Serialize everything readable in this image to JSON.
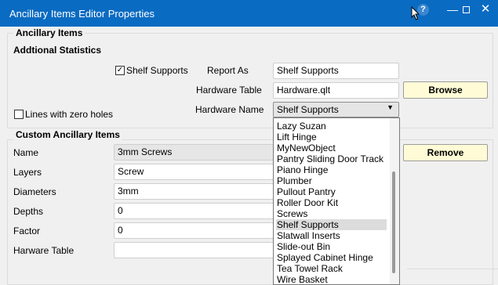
{
  "window": {
    "title": "Ancillary Items Editor Properties",
    "help_symbol": "?",
    "minimize_symbol": "—",
    "close_symbol": "✕"
  },
  "ancillary_group": {
    "title": "Ancillary Items",
    "stats_heading": "Addtional Statistics",
    "shelf_supports_label": "Shelf Supports",
    "shelf_supports_checked": true,
    "lines_zero_holes_label": "Lines with zero holes",
    "lines_zero_holes_checked": false,
    "report_as_label": "Report As",
    "report_as_value": "Shelf Supports",
    "hardware_table_label": "Hardware Table",
    "hardware_table_value": "Hardware.qlt",
    "browse_label": "Browse",
    "hardware_name_label": "Hardware Name",
    "hardware_name_value": "Shelf Supports"
  },
  "dropdown": {
    "items": [
      "Lazy Suzan",
      "Lift Hinge",
      "MyNewObject",
      "Pantry Sliding Door Track",
      "Piano Hinge",
      "Plumber",
      "Pullout Pantry",
      "Roller Door Kit",
      "Screws",
      "Shelf Supports",
      "Slatwall Inserts",
      "Slide-out Bin",
      "Splayed Cabinet Hinge",
      "Tea Towel Rack",
      "Wire Basket"
    ],
    "selected_index": 9
  },
  "custom_group": {
    "title": "Custom Ancillary Items",
    "name_label": "Name",
    "name_value": "3mm Screws",
    "remove_label": "Remove",
    "layers_label": "Layers",
    "layers_value": "Screw",
    "diameters_label": "Diameters",
    "diameters_value": "3mm",
    "depths_label": "Depths",
    "depths_value": "0",
    "factor_label": "Factor",
    "factor_value": "0",
    "harware_table_label": "Harware Table",
    "harware_table_value": ""
  }
}
